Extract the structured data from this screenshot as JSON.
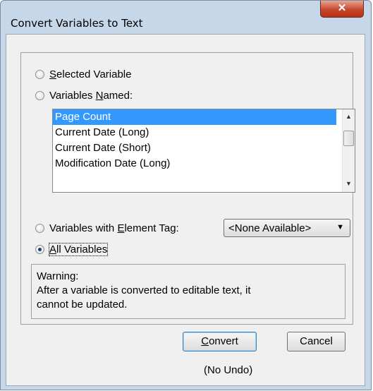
{
  "window": {
    "title": "Convert Variables to Text",
    "close_glyph": "✕"
  },
  "options": {
    "selected_variable": {
      "pre": "",
      "mnemonic": "S",
      "post": "elected Variable",
      "checked": false
    },
    "variables_named": {
      "pre": "Variables ",
      "mnemonic": "N",
      "post": "amed:",
      "checked": false
    },
    "variables_with_tag": {
      "pre": "Variables with ",
      "mnemonic": "E",
      "post": "lement Tag:",
      "checked": false
    },
    "all_variables": {
      "pre": "",
      "mnemonic": "A",
      "post": "ll Variables",
      "checked": true
    }
  },
  "variables_list": {
    "items": [
      "Page Count",
      "Current Date (Long)",
      "Current Date (Short)",
      "Modification Date (Long)"
    ],
    "selected_index": 0
  },
  "element_tag_dropdown": {
    "value": "<None Available>"
  },
  "warning": {
    "heading": "Warning:",
    "line1": "After a variable is converted to editable text, it",
    "line2": "cannot be updated."
  },
  "buttons": {
    "convert": {
      "pre": "",
      "mnemonic": "C",
      "post": "onvert"
    },
    "cancel": "Cancel"
  },
  "note": "(No Undo)"
}
